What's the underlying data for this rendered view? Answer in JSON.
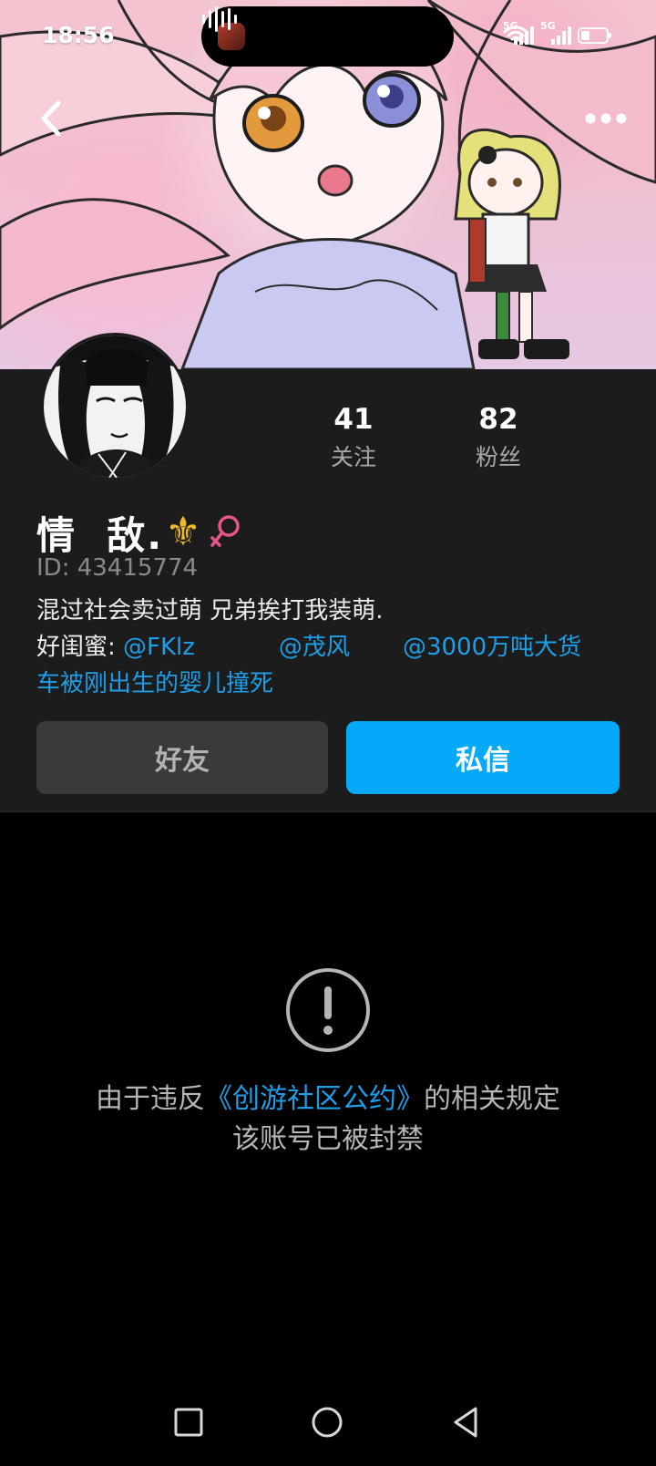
{
  "status_bar": {
    "time": "18:56",
    "network_1": "5G",
    "network_2": "5G"
  },
  "profile": {
    "following_count": "41",
    "following_label": "关注",
    "followers_count": "82",
    "followers_label": "粉丝",
    "name": "情  敌.",
    "name_emblem": "⚜",
    "id_text": "ID: 43415774",
    "bio_line1": "混过社会卖过萌 兄弟挨打我装萌.",
    "bio_prefix": "好闺蜜: ",
    "mention_1": "@FKlz",
    "mention_2": "@茂风",
    "mention_3_part1": "@3000万吨大货",
    "mention_3_part2": "车被刚出生的婴儿撞死"
  },
  "actions": {
    "friend_label": "好友",
    "message_label": "私信"
  },
  "ban_notice": {
    "text_before": "由于违反",
    "link": "《创游社区公约》",
    "text_after": "的相关规定",
    "line2": "该账号已被封禁"
  },
  "colors": {
    "accent": "#06a8f8",
    "link": "#1f9ee8",
    "panel": "#1c1c1c",
    "gender": "#e8558c",
    "emblem": "#f0b92a"
  },
  "icons": {
    "back": "chevron-left-icon",
    "more": "more-dots-icon",
    "gender": "female-icon",
    "warning": "exclamation-circle-icon",
    "nav": [
      "square-icon",
      "circle-icon",
      "triangle-back-icon"
    ]
  }
}
